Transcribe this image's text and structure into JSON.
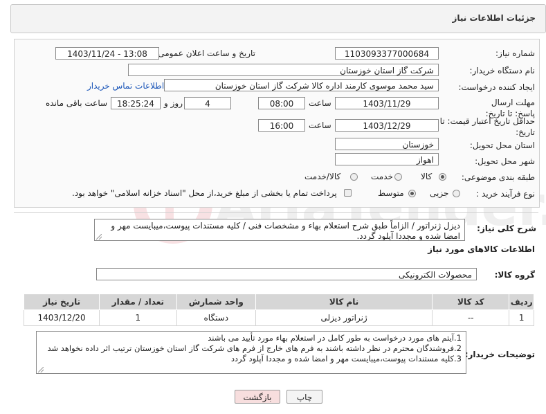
{
  "header": {
    "title": "جزئیات اطلاعات نیاز"
  },
  "form": {
    "need_number_label": "شماره نیاز:",
    "need_number": "1103093377000684",
    "announce_label": "تاریخ و ساعت اعلان عمومی:",
    "announce_value": "1403/11/24 - 13:08",
    "buyer_org_label": "نام دستگاه خریدار:",
    "buyer_org": "شرکت گاز استان خوزستان",
    "creator_label": "ایجاد کننده درخواست:",
    "creator": "سید محمد موسوی کارمند اداره کالا شرکت گاز استان خوزستان",
    "contact_link": "اطلاعات تماس خریدار",
    "reply_deadline_label": "مهلت ارسال پاسخ: تا تاریخ:",
    "reply_date": "1403/11/29",
    "time_label": "ساعت",
    "reply_time": "08:00",
    "days_value": "4",
    "days_label": "روز و",
    "remaining_value": "18:25:24",
    "remaining_label": "ساعت باقی مانده",
    "price_valid_label": "حداقل تاریخ اعتبار قیمت: تا تاریخ:",
    "price_valid_date": "1403/12/29",
    "price_time_label": "ساعت",
    "price_valid_time": "16:00",
    "province_label": "استان محل تحویل:",
    "province": "خوزستان",
    "city_label": "شهر محل تحویل:",
    "city": "اهواز",
    "category_label": "طبقه بندی موضوعی:",
    "category_options": [
      "کالا",
      "خدمت",
      "کالا/خدمت"
    ],
    "process_label": "نوع فرآیند خرید :",
    "process_options": [
      "جزیی",
      "متوسط"
    ],
    "payment_note": "پرداخت تمام یا بخشی از مبلغ خرید،از محل \"اسناد خزانه اسلامی\" خواهد بود."
  },
  "summary": {
    "label": "شرح کلی نیاز:",
    "text": "دیزل ژنراتور / الزاماً طبق شرح استعلام بهاء و مشخصات فنی / کلیه مستندات پیوست،میبایست مهر و امضا شده و مجددا آپلود گردد."
  },
  "goods": {
    "section_title": "اطلاعات کالاهای مورد نیاز",
    "group_label": "گروه کالا:",
    "group_value": "محصولات الکترونیکی",
    "columns": [
      "ردیف",
      "کد کالا",
      "نام کالا",
      "واحد شمارش",
      "تعداد / مقدار",
      "تاریخ نیاز"
    ],
    "rows": [
      [
        "1",
        "--",
        "ژنراتور دیزلی",
        "دستگاه",
        "1",
        "1403/12/20"
      ]
    ]
  },
  "buyer_notes": {
    "label": "توضیحات خریدار:",
    "lines": [
      "1.آیتم های مورد درخواست به طور کامل در استعلام بهاء مورد تأیید می باشند",
      "2.فروشندگان محترم در نظر داشته باشند به فرم های خارج از فرم های شرکت گاز استان خوزستان ترتیب اثر داده نخواهد شد",
      "3.کلیه مستندات پیوست،میبایست مهر و امضا شده و مجددا آپلود گردد"
    ]
  },
  "buttons": {
    "print": "چاپ",
    "back": "بازگشت"
  },
  "colors": {
    "link": "#1a55b8",
    "back_button_bg": "#f7dede",
    "table_header": "#d6d6d6"
  }
}
